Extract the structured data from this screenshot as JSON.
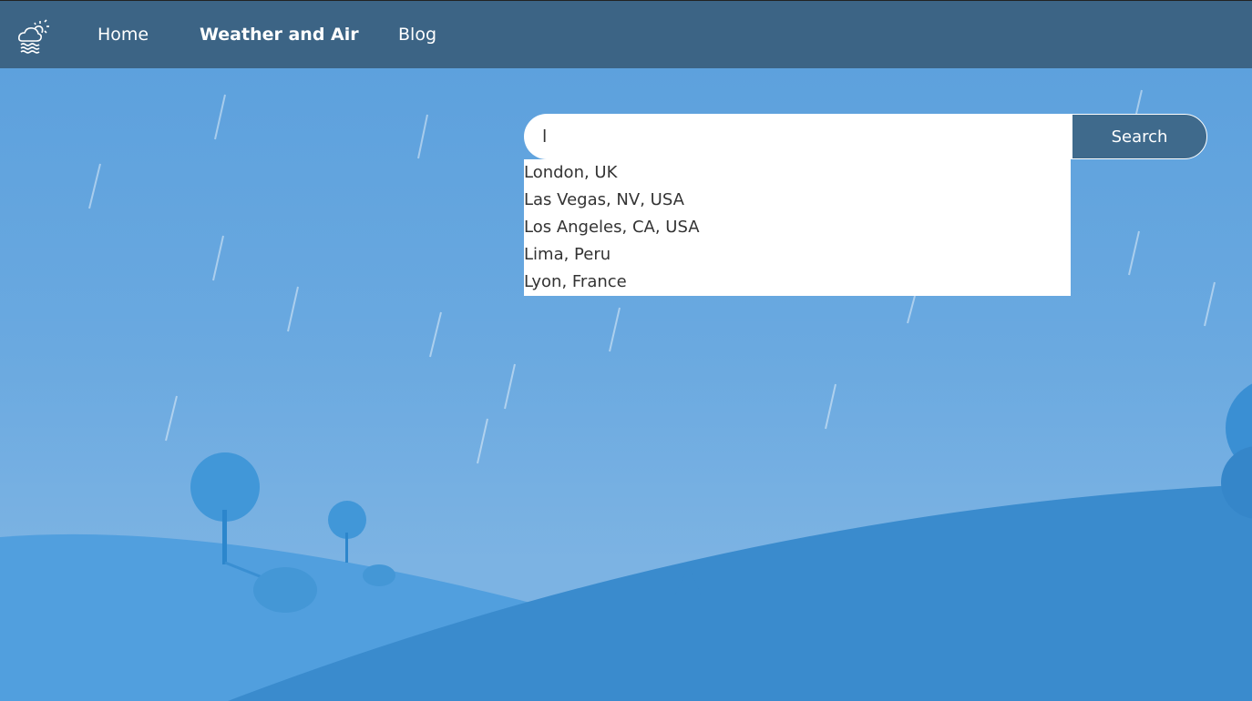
{
  "nav": {
    "items": [
      {
        "label": "Home"
      },
      {
        "label": "Weather and Air"
      },
      {
        "label": "Blog"
      }
    ]
  },
  "search": {
    "value": "l",
    "button": "Search"
  },
  "suggestions": [
    "London, UK",
    "Las Vegas, NV, USA",
    "Los Angeles, CA, USA",
    "Lima, Peru",
    "Lyon, France"
  ]
}
